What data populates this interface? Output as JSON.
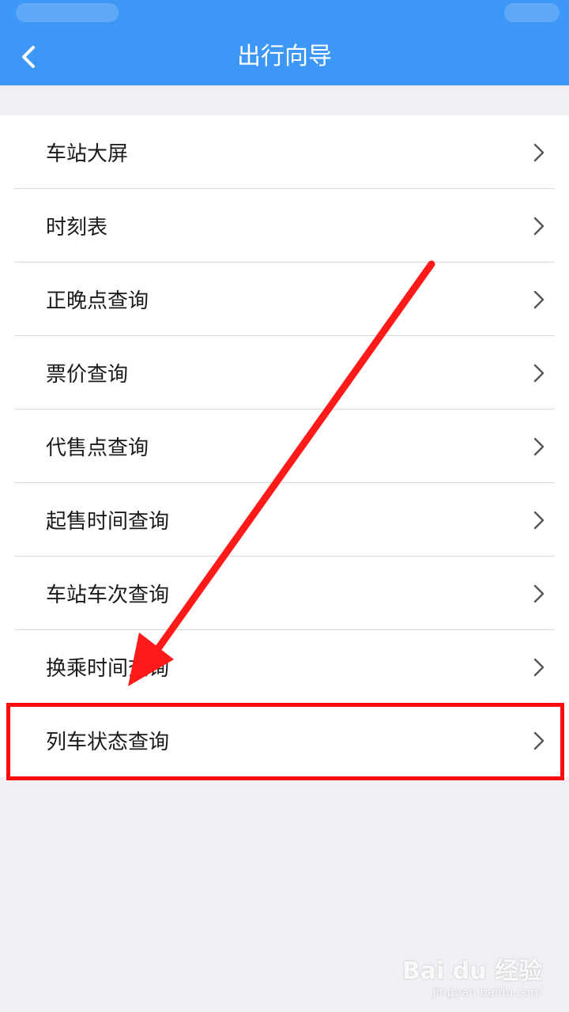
{
  "header": {
    "title": "出行向导",
    "back_icon": "chevron-left-icon",
    "background_color": "#3d97f6"
  },
  "menu": {
    "items": [
      {
        "label": "车站大屏",
        "icon": "chevron-right-icon"
      },
      {
        "label": "时刻表",
        "icon": "chevron-right-icon"
      },
      {
        "label": "正晚点查询",
        "icon": "chevron-right-icon"
      },
      {
        "label": "票价查询",
        "icon": "chevron-right-icon"
      },
      {
        "label": "代售点查询",
        "icon": "chevron-right-icon"
      },
      {
        "label": "起售时间查询",
        "icon": "chevron-right-icon"
      },
      {
        "label": "车站车次查询",
        "icon": "chevron-right-icon"
      },
      {
        "label": "换乘时间查询",
        "icon": "chevron-right-icon"
      },
      {
        "label": "列车状态查询",
        "icon": "chevron-right-icon",
        "highlighted": true
      }
    ]
  },
  "annotation": {
    "highlight_color": "#ff0a0a"
  },
  "watermark": {
    "main": "Bai du 经验",
    "sub": "jingyan.baidu.com"
  }
}
